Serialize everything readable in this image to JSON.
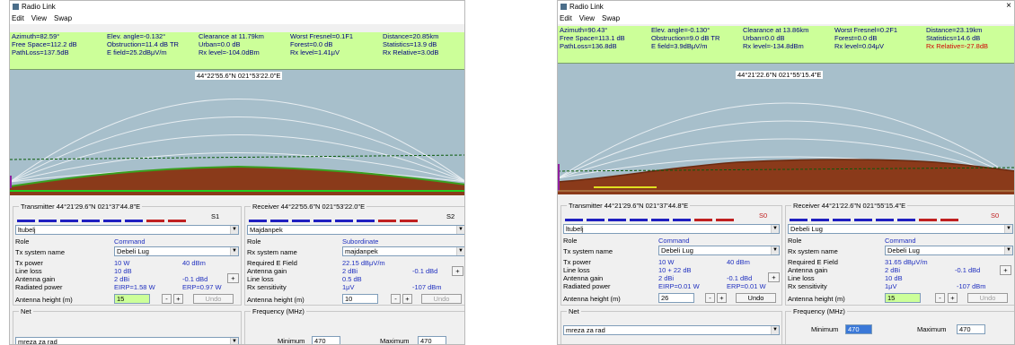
{
  "left": {
    "title": "Radio Link",
    "menu": [
      "Edit",
      "View",
      "Swap"
    ],
    "info": {
      "azimuth": "Azimuth=82.59°",
      "free_space": "Free Space=112.2 dB",
      "path_loss": "PathLoss=137.5dB",
      "elev": "Elev. angle=-0.132°",
      "obstruction": "Obstruction=11.4 dB TR",
      "efield": "E field=25.2dBμV/m",
      "clearance": "Clearance at 11.79km",
      "urban": "Urban=0.0 dB",
      "rxlevel_dbm": "Rx level=-104.0dBm",
      "fresnel": "Worst Fresnel=0.1F1",
      "forest": "Forest=0.0 dB",
      "rxlevel_uv": "Rx level=1.41μV",
      "distance": "Distance=20.85km",
      "statistics": "Statistics=13.9 dB",
      "rx_relative": "Rx Relative=3.0dB"
    },
    "plot_coord": "44°22'55.6\"N 021°53'22.0\"E",
    "transmitter": {
      "title": "Transmitter 44°21'29.6\"N 021°37'44.8\"E",
      "signal": "S1",
      "unit": "ltubelj",
      "role_label": "Role",
      "role": "Command",
      "sys_label": "Tx system name",
      "sys": "Debeli Lug",
      "pow_label": "Tx power",
      "pow_w": "10 W",
      "pow_dbm": "40 dBm",
      "loss_label": "Line loss",
      "loss": "10 dB",
      "gain_label": "Antenna gain",
      "gain_dbi": "2 dBi",
      "gain_dbd": "-0.1 dBd",
      "rad_label": "Radiated power",
      "eirp": "EIRP=1.58 W",
      "erp": "ERP=0.97 W",
      "height_label": "Antenna height (m)",
      "height": "15",
      "minus": "-",
      "plus": "+",
      "undo": "Undo"
    },
    "receiver": {
      "title": "Receiver 44°22'55.6\"N 021°53'22.0\"E",
      "signal": "S2",
      "unit": "Majdanpek",
      "role_label": "Role",
      "role": "Subordinate",
      "sys_label": "Rx system name",
      "sys": "majdanpek",
      "req_label": "Required E Field",
      "req": "22.15 dBμV/m",
      "gain_label": "Antenna gain",
      "gain_dbi": "2 dBi",
      "gain_dbd": "-0.1 dBd",
      "loss_label": "Line loss",
      "loss": "0.5 dB",
      "sens_label": "Rx sensitivity",
      "sens_uv": "1μV",
      "sens_dbm": "-107 dBm",
      "height_label": "Antenna height (m)",
      "height": "10",
      "minus": "-",
      "plus": "+",
      "undo": "Undo"
    },
    "net": {
      "label": "Net",
      "value": "mreza za rad"
    },
    "freq": {
      "label": "Frequency (MHz)",
      "min_label": "Minimum",
      "min": "470",
      "max_label": "Maximum",
      "max": "470"
    }
  },
  "right": {
    "title": "Radio Link",
    "close": "×",
    "menu": [
      "Edit",
      "View",
      "Swap"
    ],
    "info": {
      "azimuth": "Azimuth=90.43°",
      "free_space": "Free Space=113.1 dB",
      "path_loss": "PathLoss=136.8dB",
      "elev": "Elev. angle=-0.130°",
      "obstruction": "Obstruction=9.0 dB TR",
      "efield": "E field=3.9dBμV/m",
      "clearance": "Clearance at 13.86km",
      "urban": "Urban=0.0 dB",
      "rxlevel_dbm": "Rx level=-134.8dBm",
      "fresnel": "Worst Fresnel=0.2F1",
      "forest": "Forest=0.0 dB",
      "rxlevel_uv": "Rx level=0.04μV",
      "distance": "Distance=23.19km",
      "statistics": "Statistics=14.6 dB",
      "rx_relative": "Rx Relative=-27.8dB"
    },
    "plot_coord": "44°21'22.6\"N 021°55'15.4\"E",
    "transmitter": {
      "title": "Transmitter 44°21'29.6\"N 021°37'44.8\"E",
      "signal": "S0",
      "unit": "ltubelj",
      "role_label": "Role",
      "role": "Command",
      "sys_label": "Tx system name",
      "sys": "Debeli Lug",
      "pow_label": "Tx power",
      "pow_w": "10 W",
      "pow_dbm": "40 dBm",
      "loss_label": "Line loss",
      "loss": "10 + 22 dB",
      "gain_label": "Antenna gain",
      "gain_dbi": "2 dBi",
      "gain_dbd": "-0.1 dBd",
      "rad_label": "Radiated power",
      "eirp": "EIRP=0.01 W",
      "erp": "ERP=0.01 W",
      "height_label": "Antenna height (m)",
      "height": "26",
      "minus": "-",
      "plus": "+",
      "undo": "Undo"
    },
    "receiver": {
      "title": "Receiver 44°21'22.6\"N 021°55'15.4\"E",
      "signal": "S0",
      "unit": "Debeli Lug",
      "role_label": "Role",
      "role": "Command",
      "sys_label": "Rx system name",
      "sys": "Debeli Lug",
      "req_label": "Required E Field",
      "req": "31.65 dBμV/m",
      "gain_label": "Antenna gain",
      "gain_dbi": "2 dBi",
      "gain_dbd": "-0.1 dBd",
      "loss_label": "Line loss",
      "loss": "10 dB",
      "sens_label": "Rx sensitivity",
      "sens_uv": "1μV",
      "sens_dbm": "-107 dBm",
      "height_label": "Antenna height (m)",
      "height": "15",
      "minus": "-",
      "plus": "+",
      "undo": "Undo"
    },
    "net": {
      "label": "Net",
      "value": "mreza za rad"
    },
    "freq": {
      "label": "Frequency (MHz)",
      "min_label": "Minimum",
      "min": "470",
      "max_label": "Maximum",
      "max": "470"
    }
  },
  "colors": {
    "info_bg": "#ccff99",
    "plot_bg": "#a7bfcb",
    "terrain": "#8a3a1a",
    "accent_red": "#d00000"
  }
}
